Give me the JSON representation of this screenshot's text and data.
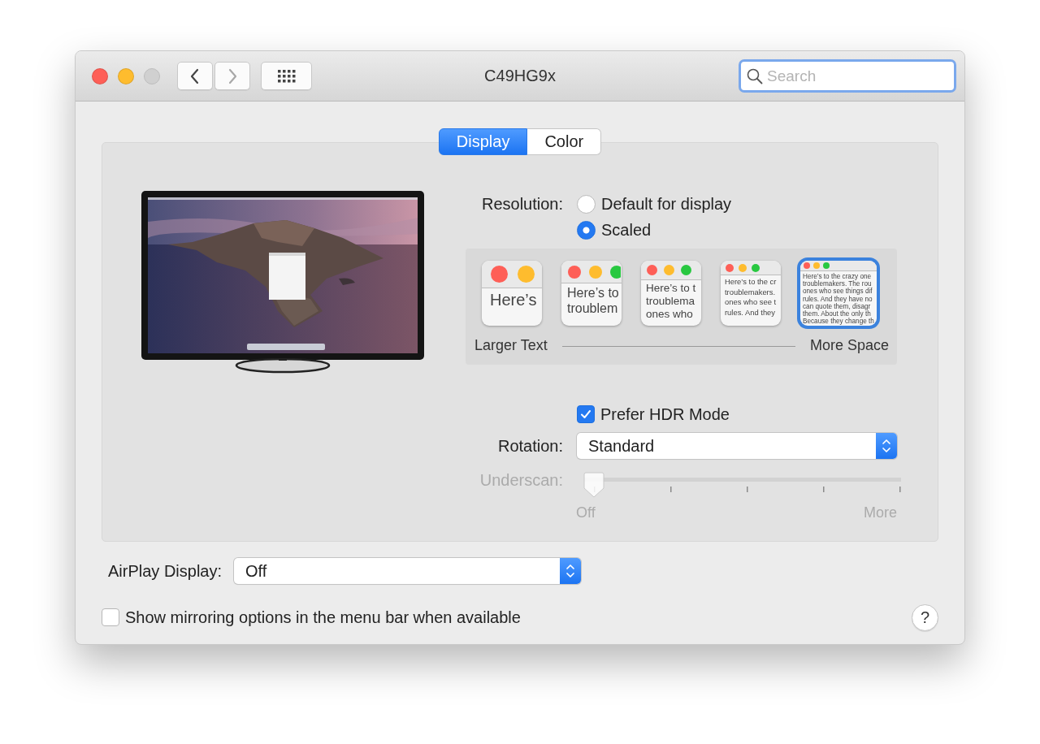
{
  "window": {
    "title": "C49HG9x",
    "buttons": [
      {
        "kind": "close",
        "disabled": false
      },
      {
        "kind": "minimize",
        "disabled": false
      },
      {
        "kind": "zoom",
        "disabled": true
      }
    ]
  },
  "toolbar": {
    "nav": [
      {
        "kind": "back",
        "disabled": false
      },
      {
        "kind": "forward",
        "disabled": true
      }
    ],
    "search": {
      "placeholder": "Search",
      "focused": true
    }
  },
  "tabs": [
    {
      "label": "Display",
      "selected": true
    },
    {
      "label": "Color",
      "selected": false
    }
  ],
  "resolution": {
    "label": "Resolution:",
    "options": [
      {
        "label": "Default for display",
        "selected": false
      },
      {
        "label": "Scaled",
        "selected": true
      }
    ]
  },
  "scaled_sizes": {
    "options": [
      {
        "lines": [
          "Here’s"
        ],
        "selected": false
      },
      {
        "lines": [
          "Here’s to",
          "troublem"
        ],
        "selected": false
      },
      {
        "lines": [
          "Here’s to t",
          "troublema",
          "ones who"
        ],
        "selected": false
      },
      {
        "lines": [
          "Here’s to the cr",
          "troublemakers.",
          "ones who see t",
          "rules. And they"
        ],
        "selected": false
      },
      {
        "lines": [
          "Here’s to the crazy one",
          "troublemakers. The rou",
          "ones who see things dif",
          "rules. And they have no",
          "can quote them, disagr",
          "them. About the only th",
          "Because they change th"
        ],
        "selected": true
      }
    ],
    "left_label": "Larger Text",
    "right_label": "More Space"
  },
  "hdr": {
    "label": "Prefer HDR Mode",
    "checked": true
  },
  "rotation": {
    "label": "Rotation:",
    "value": "Standard"
  },
  "underscan": {
    "label": "Underscan:",
    "disabled": true,
    "level": 0,
    "min_label": "Off",
    "max_label": "More"
  },
  "airplay": {
    "label": "AirPlay Display:",
    "value": "Off"
  },
  "mirroring": {
    "label": "Show mirroring options in the menu bar when available",
    "checked": false
  },
  "help": {
    "label": "?"
  }
}
